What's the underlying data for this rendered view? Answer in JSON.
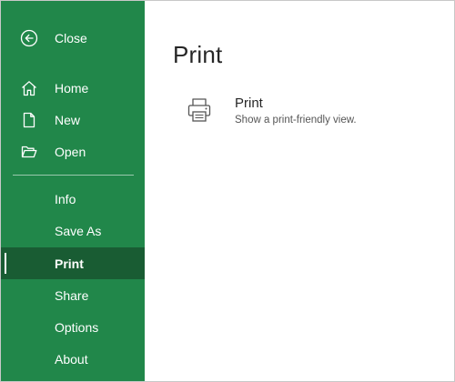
{
  "sidebar": {
    "back": {
      "label": "Close",
      "icon": "back-arrow-icon"
    },
    "items": [
      {
        "label": "Home",
        "icon": "home-icon"
      },
      {
        "label": "New",
        "icon": "new-document-icon"
      },
      {
        "label": "Open",
        "icon": "open-folder-icon"
      },
      {
        "label": "Info"
      },
      {
        "label": "Save As"
      },
      {
        "label": "Print",
        "selected": true
      },
      {
        "label": "Share"
      },
      {
        "label": "Options"
      },
      {
        "label": "About"
      }
    ]
  },
  "main": {
    "title": "Print",
    "option": {
      "title": "Print",
      "description": "Show a print-friendly view.",
      "icon": "printer-icon"
    }
  },
  "colors": {
    "sidebar_bg": "#21874a",
    "sidebar_selected_bg": "#195c33",
    "text_dark": "#262626"
  }
}
